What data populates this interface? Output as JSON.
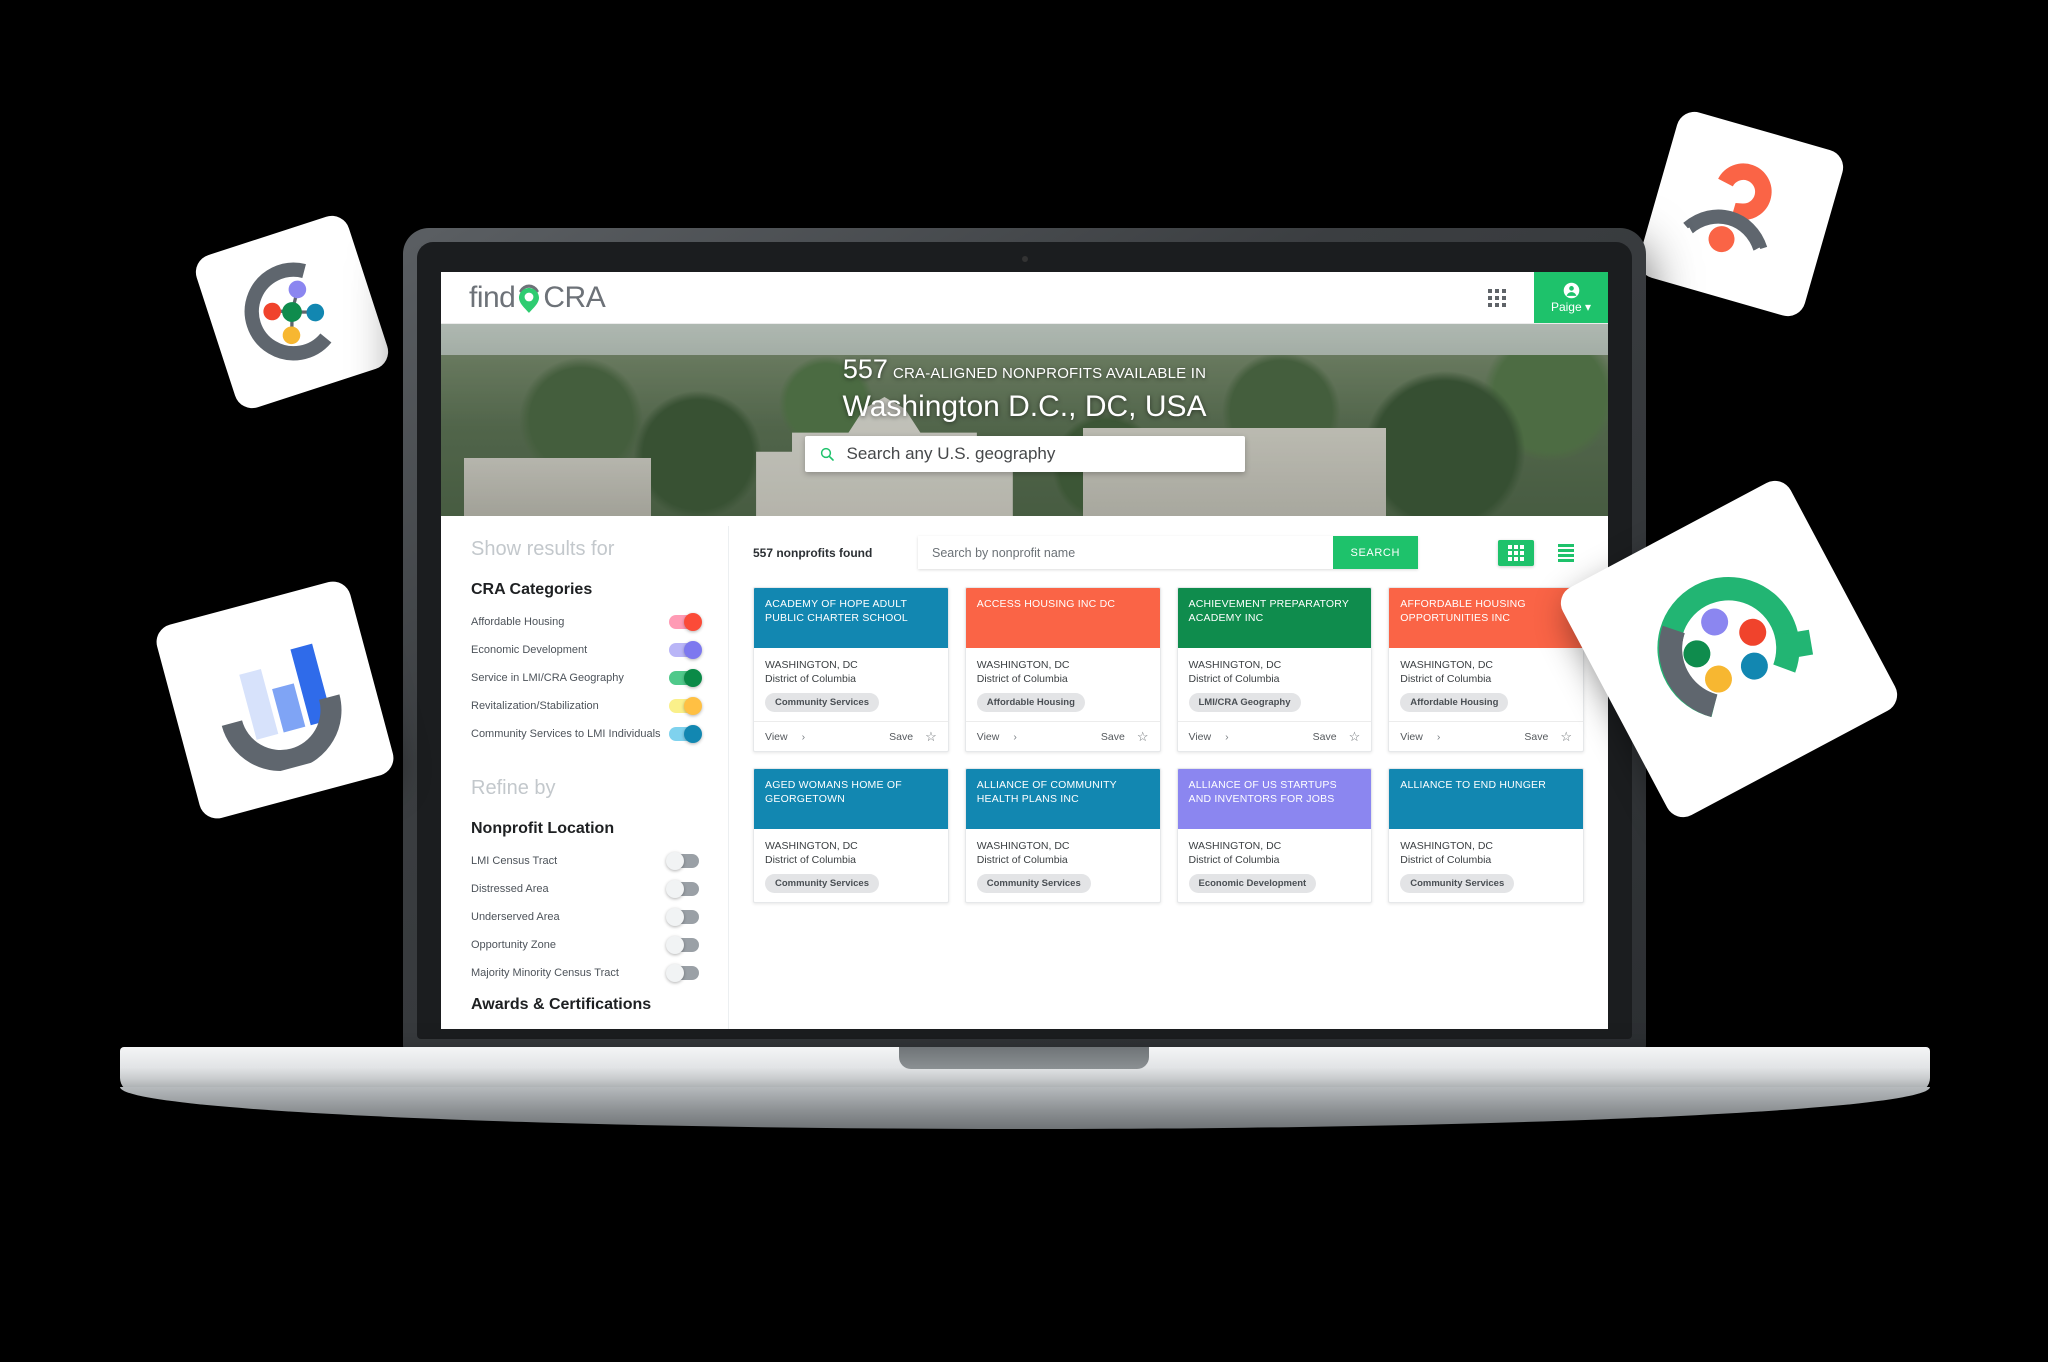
{
  "brand": {
    "logo_text_left": "find",
    "logo_text_right": "CRA",
    "logo_pin_icon": "map-pin-icon",
    "accent_green": "#1ec26b",
    "accent_orange": "#fa6446",
    "accent_blue": "#1287b1",
    "accent_purple": "#8b86f0",
    "accent_darkgreen": "#0f8c4d"
  },
  "header": {
    "apps_icon": "grid-apps-icon",
    "account_icon": "account-circle-icon",
    "account_name": "Paige",
    "account_caret": "▾"
  },
  "hero": {
    "count": "557",
    "subtitle": "CRA-ALIGNED NONPROFITS AVAILABLE IN",
    "place": "Washington D.C., DC, USA",
    "search_icon": "search-icon",
    "search_placeholder": "Search any U.S. geography",
    "search_value": ""
  },
  "sidebar": {
    "show_results_label": "Show results for",
    "cra_categories_title": "CRA Categories",
    "cra_categories": [
      {
        "label": "Affordable Housing",
        "on": true,
        "track": "#ff9bb5",
        "knob": "#fb4b38"
      },
      {
        "label": "Economic Development",
        "on": true,
        "track": "#b9b5f7",
        "knob": "#7d78ef"
      },
      {
        "label": "Service in LMI/CRA Geography",
        "on": true,
        "track": "#4fc98a",
        "knob": "#0a8a47"
      },
      {
        "label": "Revitalization/Stabilization",
        "on": true,
        "track": "#faf08a",
        "knob": "#ffc githubc43"
      },
      {
        "label": "Community Services to LMI Individuals",
        "on": true,
        "track": "#7fd2ee",
        "knob": "#1287b1"
      }
    ],
    "refine_by_label": "Refine by",
    "nonprofit_location_title": "Nonprofit Location",
    "nonprofit_location": [
      {
        "label": "LMI Census Tract",
        "on": false
      },
      {
        "label": "Distressed Area",
        "on": false
      },
      {
        "label": "Underserved Area",
        "on": false
      },
      {
        "label": "Opportunity Zone",
        "on": false
      },
      {
        "label": "Majority Minority Census Tract",
        "on": false
      }
    ],
    "awards_title": "Awards & Certifications"
  },
  "results": {
    "found_label": "557 nonprofits found",
    "name_search_placeholder": "Search by nonprofit name",
    "name_search_value": "",
    "search_button": "SEARCH",
    "grid_view_icon": "grid-view-icon",
    "list_view_icon": "list-view-icon",
    "active_view": "grid",
    "card_actions": {
      "view": "View",
      "chevron": "›",
      "save": "Save",
      "star_icon": "star-outline-icon"
    },
    "cards": [
      {
        "name": "ACADEMY OF HOPE ADULT PUBLIC CHARTER SCHOOL",
        "city": "WASHINGTON, DC",
        "state": "District of Columbia",
        "tag": "Community Services",
        "color": "#1287b1"
      },
      {
        "name": "ACCESS HOUSING INC DC",
        "city": "WASHINGTON, DC",
        "state": "District of Columbia",
        "tag": "Affordable Housing",
        "color": "#fa6446"
      },
      {
        "name": "ACHIEVEMENT PREPARATORY ACADEMY INC",
        "city": "WASHINGTON, DC",
        "state": "District of Columbia",
        "tag": "LMI/CRA Geography",
        "color": "#0f8c4d"
      },
      {
        "name": "AFFORDABLE HOUSING OPPORTUNITIES INC",
        "city": "WASHINGTON, DC",
        "state": "District of Columbia",
        "tag": "Affordable Housing",
        "color": "#fa6446"
      },
      {
        "name": "AGED WOMANS HOME OF GEORGETOWN",
        "city": "WASHINGTON, DC",
        "state": "District of Columbia",
        "tag": "Community Services",
        "color": "#1287b1"
      },
      {
        "name": "ALLIANCE OF COMMUNITY HEALTH PLANS INC",
        "city": "WASHINGTON, DC",
        "state": "District of Columbia",
        "tag": "Community Services",
        "color": "#1287b1"
      },
      {
        "name": "ALLIANCE OF US STARTUPS AND INVENTORS FOR JOBS",
        "city": "WASHINGTON, DC",
        "state": "District of Columbia",
        "tag": "Economic Development",
        "color": "#8b86f0"
      },
      {
        "name": "ALLIANCE TO END HUNGER",
        "city": "WASHINGTON, DC",
        "state": "District of Columbia",
        "tag": "Community Services",
        "color": "#1287b1"
      }
    ]
  },
  "floating_tiles": [
    {
      "icon": "network-nodes-icon",
      "position": "top-left"
    },
    {
      "icon": "question-eye-icon",
      "position": "top-right"
    },
    {
      "icon": "bar-chart-icon",
      "position": "bottom-left"
    },
    {
      "icon": "magnifier-nodes-icon",
      "position": "right"
    }
  ]
}
